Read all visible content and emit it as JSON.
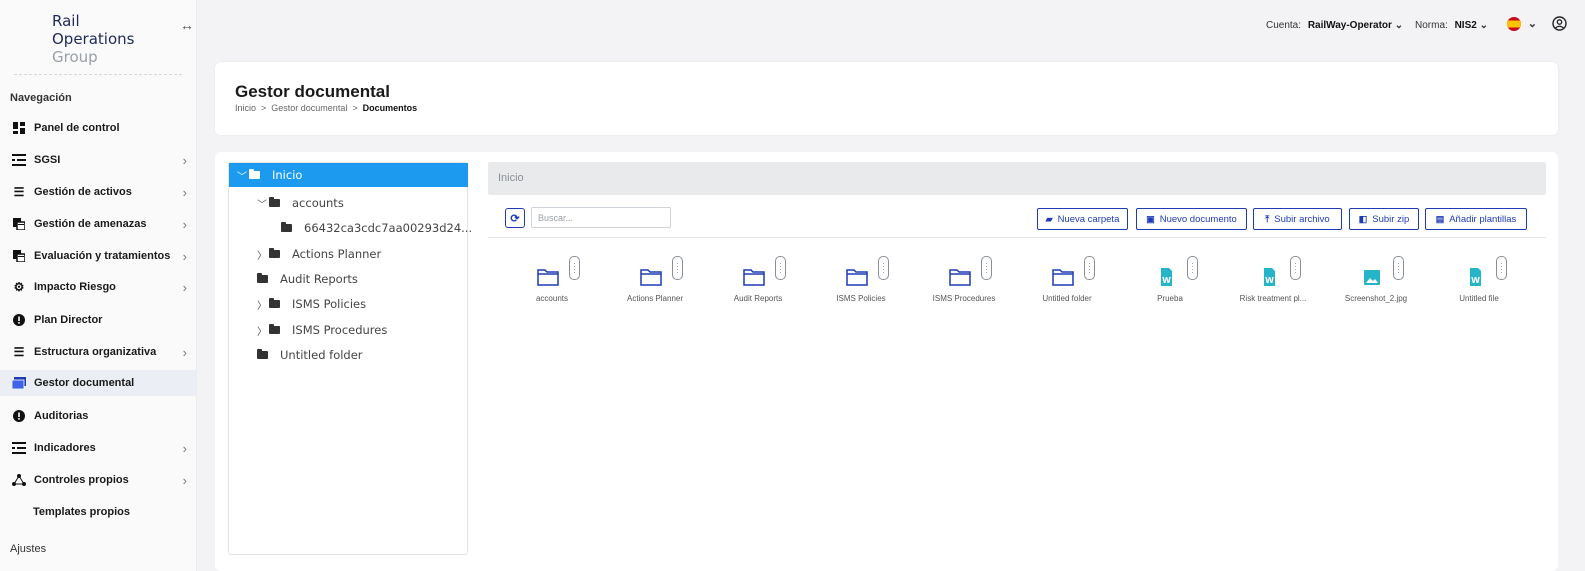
{
  "brand": {
    "line1": "Rail",
    "line2": "Operations",
    "line3": "Group"
  },
  "sidebar": {
    "nav_heading": "Navegación",
    "settings_heading": "Ajustes",
    "items": [
      {
        "label": "Panel de control",
        "icon": "dashboard-icon",
        "submenu": false
      },
      {
        "label": "SGSI",
        "icon": "list-icon",
        "submenu": true
      },
      {
        "label": "Gestión de activos",
        "icon": "bullet-list-icon",
        "submenu": true
      },
      {
        "label": "Gestión de amenazas",
        "icon": "copy-icon",
        "submenu": true
      },
      {
        "label": "Evaluación y tratamientos",
        "icon": "copy-icon",
        "submenu": true
      },
      {
        "label": "Impacto Riesgo",
        "icon": "gear-icon",
        "submenu": true
      },
      {
        "label": "Plan Director",
        "icon": "alert-icon",
        "submenu": false
      },
      {
        "label": "Estructura organizativa",
        "icon": "bullet-list-icon",
        "submenu": true
      },
      {
        "label": "Gestor documental",
        "icon": "folder-icon",
        "submenu": false,
        "active": true
      },
      {
        "label": "Auditorias",
        "icon": "alert-icon",
        "submenu": false
      },
      {
        "label": "Indicadores",
        "icon": "list-icon",
        "submenu": true
      },
      {
        "label": "Controles propios",
        "icon": "network-icon",
        "submenu": true
      },
      {
        "label": "Templates propios",
        "icon": "",
        "submenu": false
      }
    ]
  },
  "topbar": {
    "account_label": "Cuenta:",
    "account_value": "RailWay-Operator",
    "norm_label": "Norma:",
    "norm_value": "NIS2"
  },
  "header": {
    "title": "Gestor documental",
    "breadcrumb": [
      "Inicio",
      "Gestor documental",
      "Documentos"
    ]
  },
  "tree": [
    {
      "label": "Inicio",
      "chevron": "down",
      "selected": true
    },
    {
      "label": "accounts",
      "chevron": "down"
    },
    {
      "label": "66432ca3cdc7aa00293d24...",
      "chevron": "none"
    },
    {
      "label": "Actions Planner",
      "chevron": "right"
    },
    {
      "label": "Audit Reports",
      "chevron": "none"
    },
    {
      "label": "ISMS Policies",
      "chevron": "right"
    },
    {
      "label": "ISMS Procedures",
      "chevron": "right"
    },
    {
      "label": "Untitled folder",
      "chevron": "none"
    }
  ],
  "content": {
    "path": "Inicio",
    "search_placeholder": "Buscar...",
    "buttons": {
      "new_folder": "Nueva carpeta",
      "new_document": "Nuevo documento",
      "upload_file": "Subir archivo",
      "upload_zip": "Subir zip",
      "add_templates": "Añadir plantillas"
    },
    "items": [
      {
        "label": "accounts",
        "type": "folder"
      },
      {
        "label": "Actions Planner",
        "type": "folder"
      },
      {
        "label": "Audit Reports",
        "type": "folder"
      },
      {
        "label": "ISMS Policies",
        "type": "folder"
      },
      {
        "label": "ISMS Procedures",
        "type": "folder"
      },
      {
        "label": "Untitled folder",
        "type": "folder"
      },
      {
        "label": "Prueba",
        "type": "word"
      },
      {
        "label": "Risk treatment pl...",
        "type": "word"
      },
      {
        "label": "Screenshot_2.jpg",
        "type": "image"
      },
      {
        "label": "Untitled file",
        "type": "word"
      }
    ]
  },
  "colors": {
    "accent": "#1f3bb3",
    "selection": "#1b9af0",
    "file_icon": "#26b5c8"
  }
}
